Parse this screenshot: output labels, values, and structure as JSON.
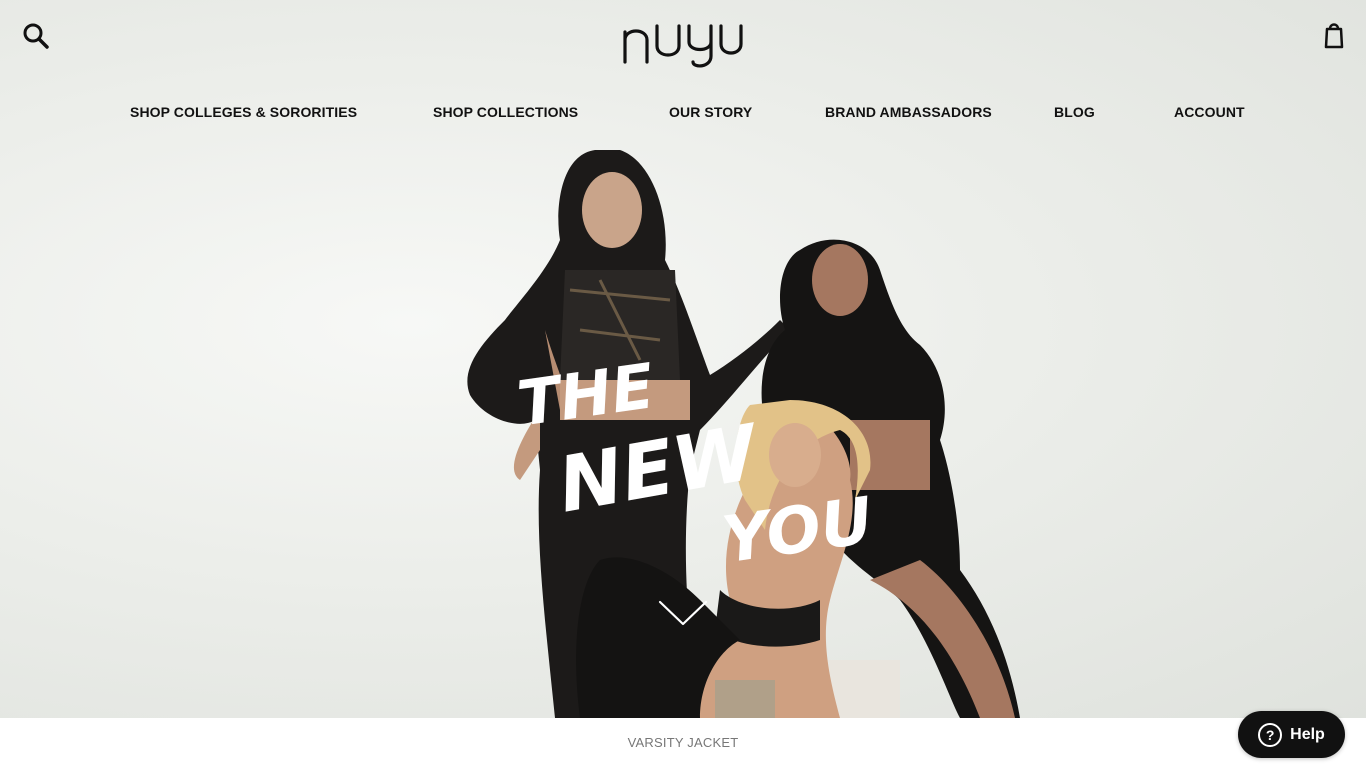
{
  "header": {
    "logo_text": "nuyu",
    "search_icon": "search-icon",
    "cart_icon": "shopping-bag-icon"
  },
  "nav": {
    "items": [
      {
        "label": "SHOP COLLEGES & SORORITIES"
      },
      {
        "label": "SHOP COLLECTIONS"
      },
      {
        "label": "OUR STORY"
      },
      {
        "label": "BRAND AMBASSADORS"
      },
      {
        "label": "BLOG"
      },
      {
        "label": "ACCOUNT"
      }
    ]
  },
  "hero": {
    "tagline_lines": [
      "THE",
      "NEW",
      "YOU"
    ],
    "scroll_icon": "chevron-down-icon"
  },
  "bottom": {
    "label": "VARSITY JACKET"
  },
  "help": {
    "label": "Help",
    "icon": "question-circle-icon"
  },
  "colors": {
    "text": "#111111",
    "help_bg": "#111111",
    "bottom_label": "#777777"
  }
}
